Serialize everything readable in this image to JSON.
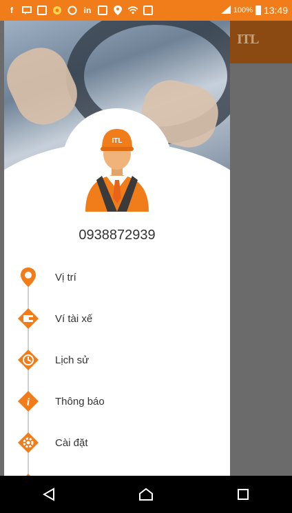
{
  "status_bar": {
    "battery_percent": "100%",
    "time": "13:49"
  },
  "app": {
    "logo_text": "ITL"
  },
  "drawer": {
    "phone_number": "0938872939",
    "avatar_cap_text": "ITL",
    "menu": [
      {
        "label": "Vị trí",
        "icon": "location-pin-icon"
      },
      {
        "label": "Ví tài xế",
        "icon": "wallet-icon"
      },
      {
        "label": "Lịch sử",
        "icon": "history-icon"
      },
      {
        "label": "Thông báo",
        "icon": "info-icon"
      },
      {
        "label": "Cài đặt",
        "icon": "settings-gear-icon"
      }
    ]
  },
  "colors": {
    "accent": "#f07d1a",
    "status_bar": "#f07d1a",
    "scrim": "#6b6b6b",
    "nav_bar": "#000000"
  }
}
